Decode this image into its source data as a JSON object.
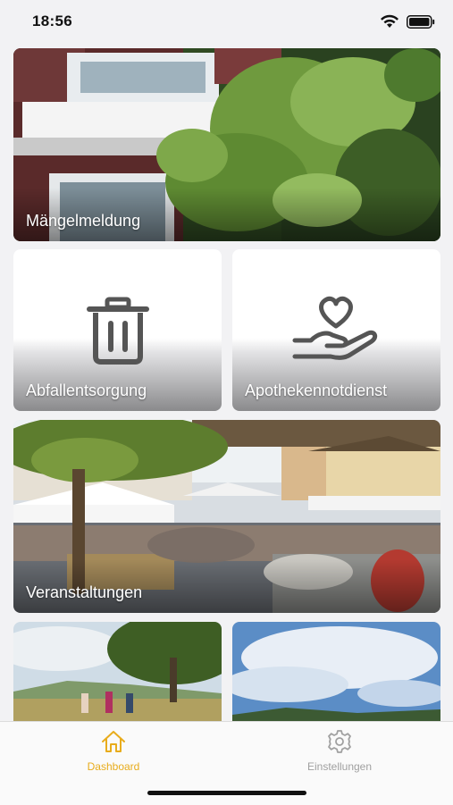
{
  "status_bar": {
    "time": "18:56"
  },
  "tiles": {
    "maengel": "Mängelmeldung",
    "abfall": "Abfallentsorgung",
    "apotheke": "Apothekennotdienst",
    "veranstaltungen": "Veranstaltungen"
  },
  "tabbar": {
    "items": [
      {
        "label": "Dashboard",
        "icon": "home-icon",
        "active": true
      },
      {
        "label": "Einstellungen",
        "icon": "gear-icon",
        "active": false
      }
    ]
  },
  "colors": {
    "accent": "#e8ac1c",
    "inactive": "#a0a0a0",
    "icon_gray": "#555555"
  }
}
